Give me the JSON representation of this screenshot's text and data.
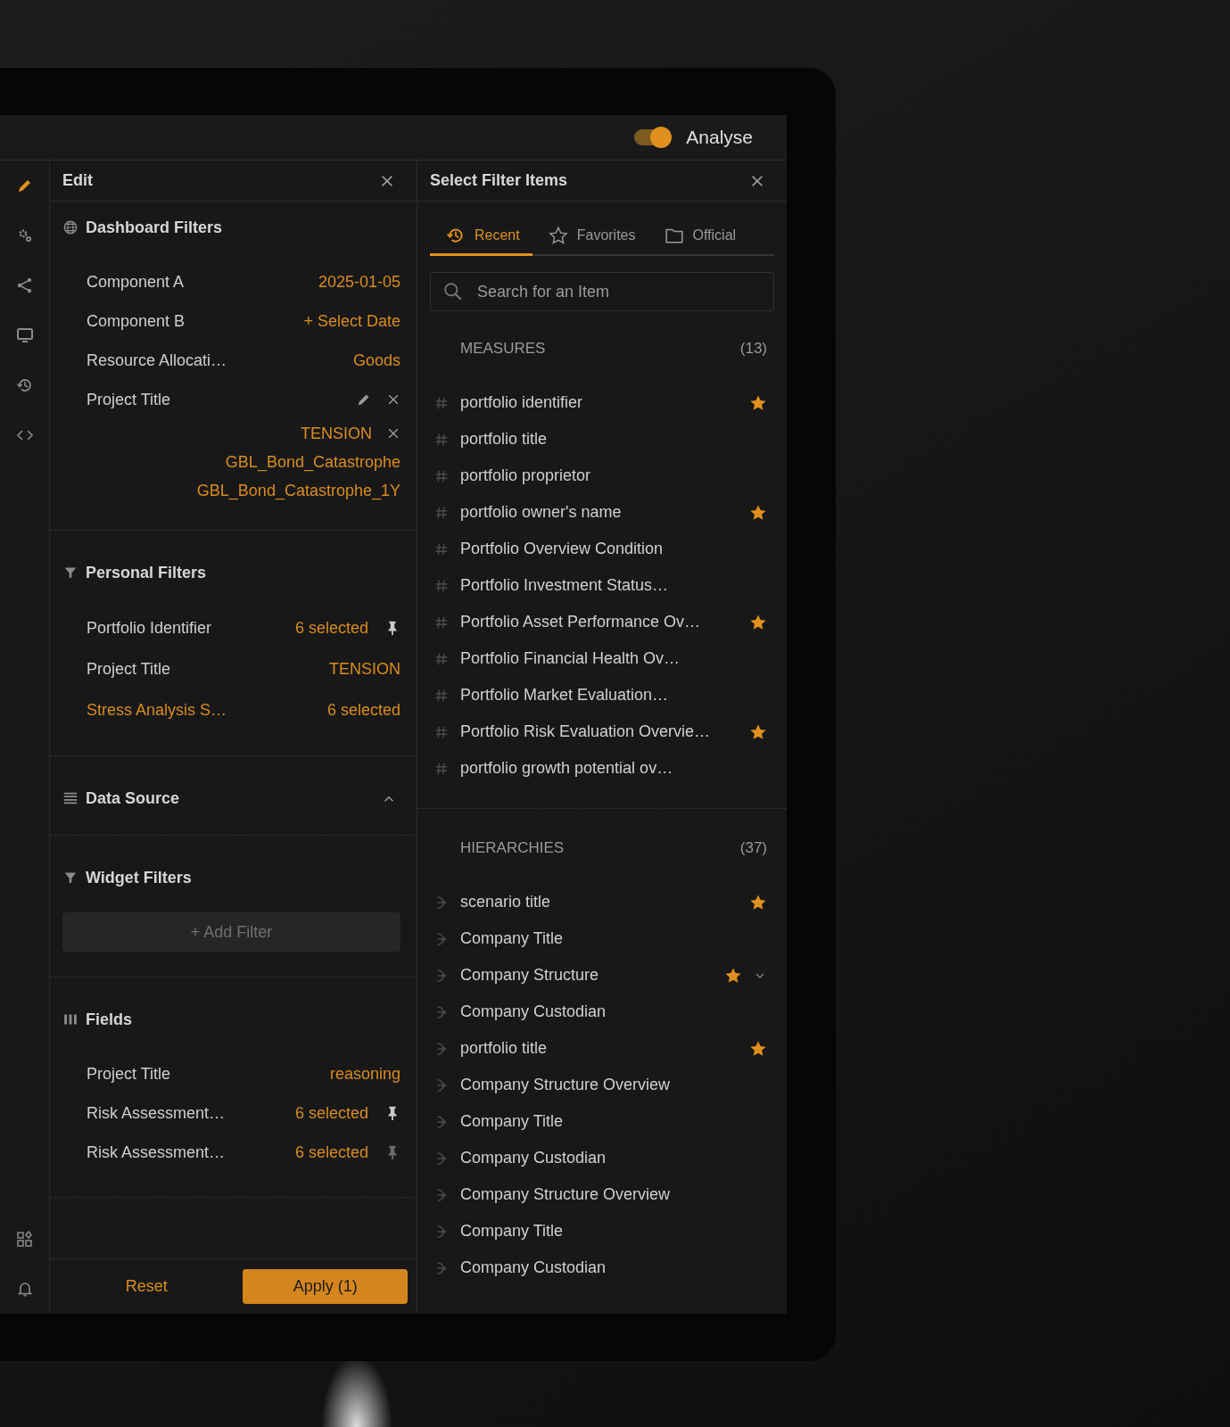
{
  "header": {
    "toggle": {
      "label": "Analyse",
      "on": true
    }
  },
  "rail": {
    "top": [
      {
        "selected": true
      },
      {
        "selected": false
      },
      {
        "selected": false
      },
      {
        "selected": false
      },
      {
        "selected": false
      },
      {
        "selected": false
      }
    ],
    "bottom": [
      {
        "selected": false
      },
      {
        "selected": false
      }
    ]
  },
  "edit_panel": {
    "title": "Edit",
    "sections": [
      {
        "kind": "dashboard_filters",
        "title": "Dashboard Filters",
        "rows": [
          {
            "label": "Component A",
            "value": "2025-01-05"
          },
          {
            "label": "Component B",
            "value": "+ Select Date"
          },
          {
            "label": "Resource Allocati…",
            "value": "Goods"
          },
          {
            "label": "Project Title",
            "editable": true,
            "removable": true,
            "values": [
              {
                "text": "TENSION",
                "removable": true
              },
              {
                "text": "GBL_Bond_Catastrophe",
                "removable": false
              },
              {
                "text": "GBL_Bond_Catastrophe_1Y",
                "removable": false
              }
            ]
          }
        ]
      },
      {
        "kind": "personal_filters",
        "title": "Personal Filters",
        "rows": [
          {
            "label": "Portfolio Identifier",
            "value": "6 selected",
            "pinned": true,
            "highlighted": false
          },
          {
            "label": "Project Title",
            "value": "TENSION",
            "highlighted": false
          },
          {
            "label": "Stress Analysis S…",
            "value": "6 selected",
            "highlighted": true
          }
        ]
      },
      {
        "kind": "data_source",
        "title": "Data Source",
        "expanded": true
      },
      {
        "kind": "widget_filters",
        "title": "Widget Filters",
        "button": "+ Add Filter"
      },
      {
        "kind": "fields",
        "title": "Fields",
        "rows": [
          {
            "label": "Project Title",
            "value": "reasoning"
          },
          {
            "label": "Risk Assessment…",
            "value": "6 selected",
            "pinned": true
          },
          {
            "label": "Risk Assessment…",
            "value": "6 selected",
            "pinned": false
          }
        ]
      }
    ],
    "footer": {
      "reset": "Reset",
      "apply": "Apply (1)"
    }
  },
  "select_panel": {
    "title": "Select Filter Items",
    "tabs": [
      {
        "label": "Recent",
        "selected": true
      },
      {
        "label": "Favorites",
        "selected": false
      },
      {
        "label": "Official",
        "selected": false
      }
    ],
    "search": {
      "placeholder": "Search for an Item"
    },
    "groups": [
      {
        "kind": "measure",
        "title": "MEASURES",
        "count": "(13)",
        "items": [
          {
            "label": "portfolio identifier",
            "favorite": true
          },
          {
            "label": "portfolio title",
            "favorite": false
          },
          {
            "label": "portfolio proprietor",
            "favorite": false
          },
          {
            "label": "portfolio owner's name",
            "favorite": true
          },
          {
            "label": "Portfolio Overview Condition",
            "favorite": false
          },
          {
            "label": "Portfolio Investment Status…",
            "favorite": false
          },
          {
            "label": "Portfolio Asset Performance Ov…",
            "favorite": true
          },
          {
            "label": "Portfolio Financial Health Ov…",
            "favorite": false
          },
          {
            "label": "Portfolio Market Evaluation…",
            "favorite": false
          },
          {
            "label": "Portfolio Risk Evaluation Overvie…",
            "favorite": true
          },
          {
            "label": "portfolio growth potential ov…",
            "favorite": false
          }
        ]
      },
      {
        "kind": "hierarchy",
        "title": "HIERARCHIES",
        "count": "(37)",
        "items": [
          {
            "label": "scenario title",
            "favorite": true
          },
          {
            "label": "Company Title",
            "favorite": false
          },
          {
            "label": "Company Structure",
            "favorite": true,
            "expanded": false
          },
          {
            "label": "Company Custodian",
            "favorite": false
          },
          {
            "label": "portfolio title",
            "favorite": true
          },
          {
            "label": "Company Structure Overview",
            "favorite": false
          },
          {
            "label": "Company Title",
            "favorite": false
          },
          {
            "label": "Company Custodian",
            "favorite": false
          },
          {
            "label": "Company Structure Overview",
            "favorite": false
          },
          {
            "label": "Company Title",
            "favorite": false
          },
          {
            "label": "Company Custodian",
            "favorite": false
          }
        ]
      }
    ]
  }
}
